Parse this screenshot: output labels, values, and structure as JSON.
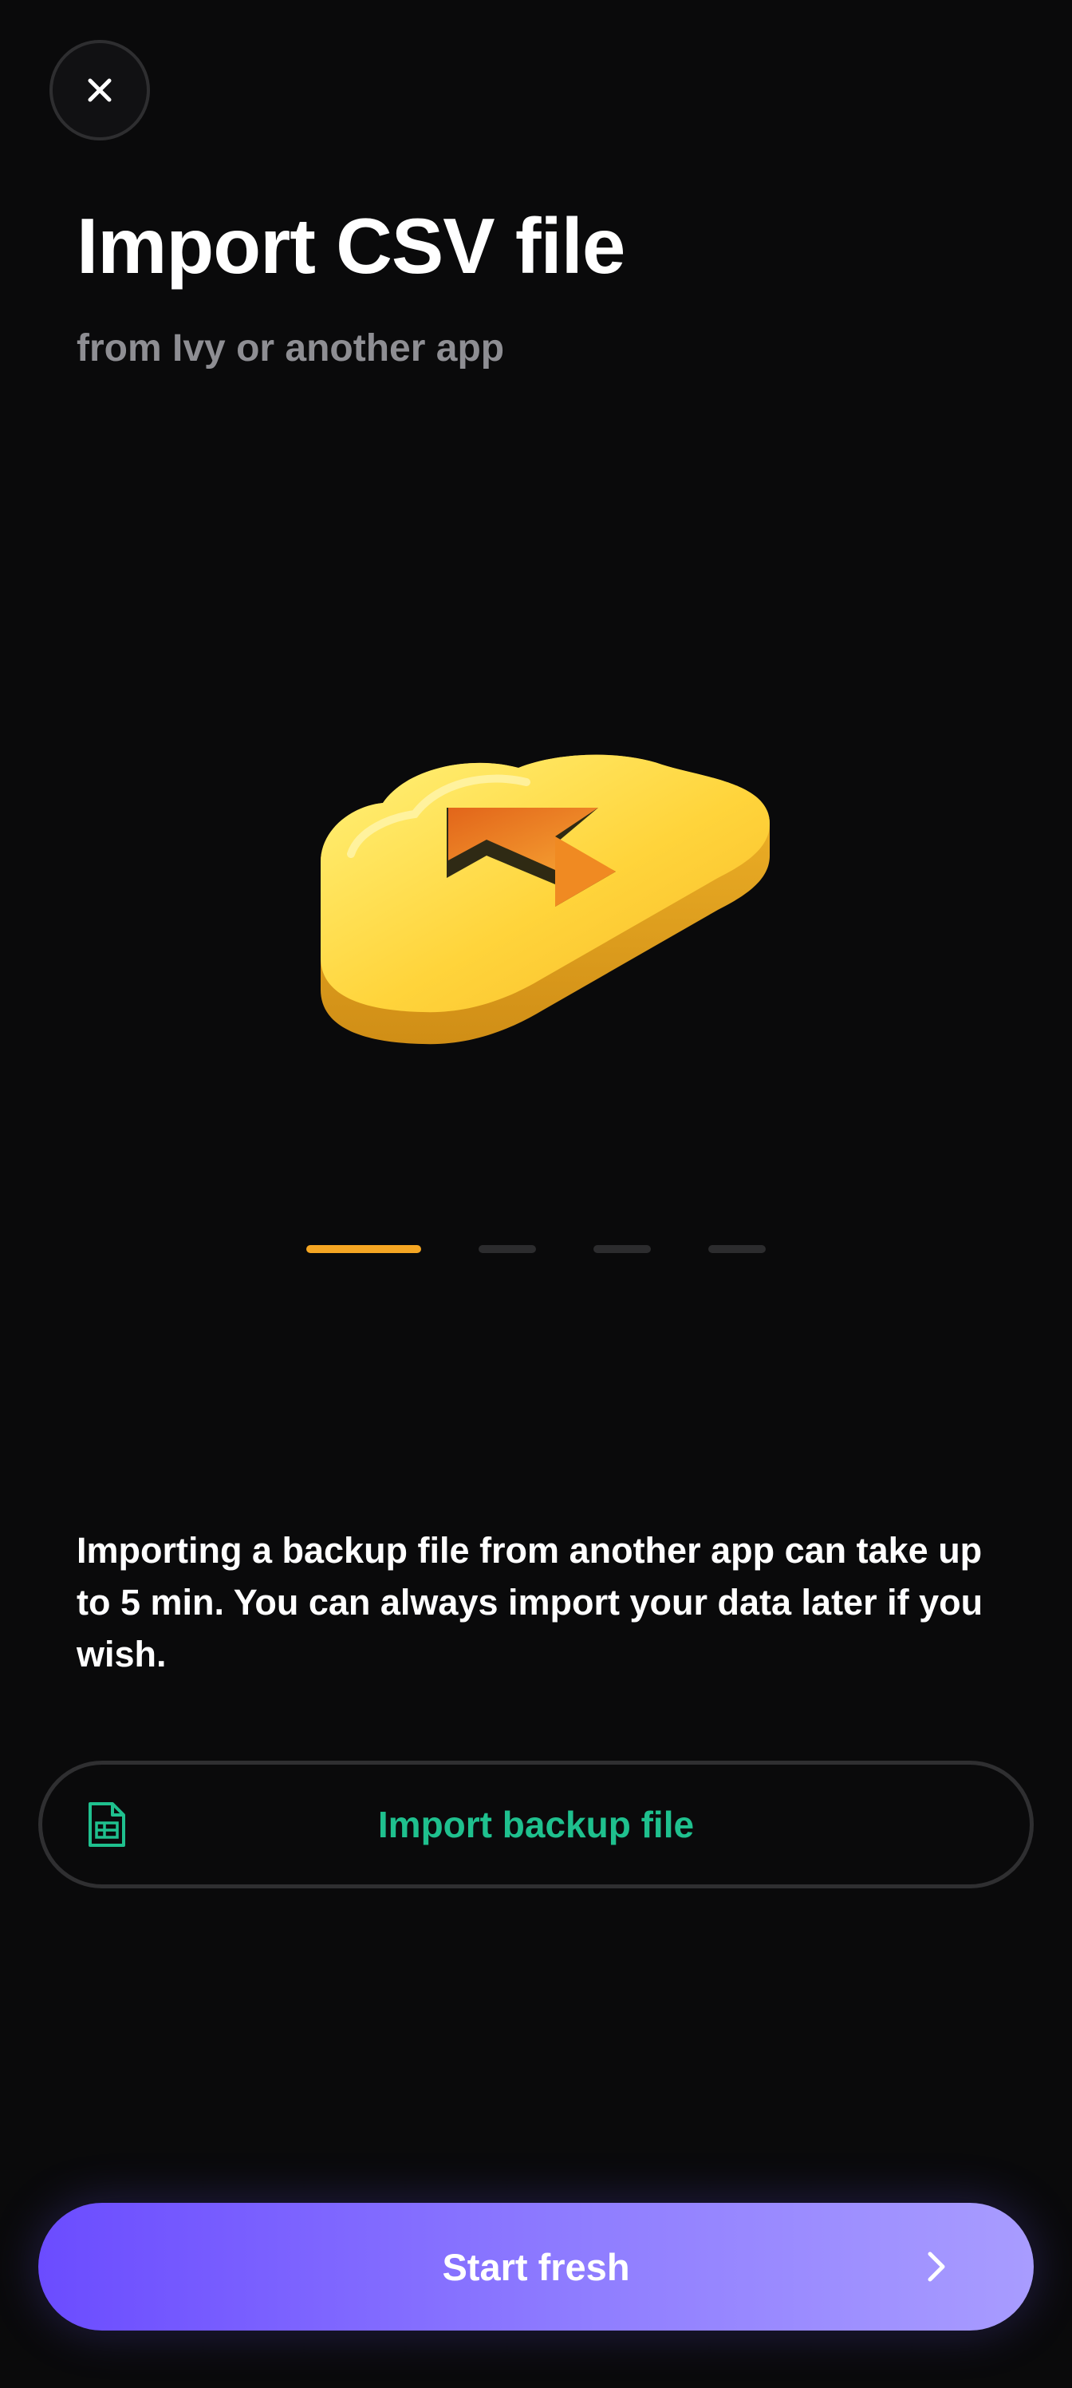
{
  "header": {
    "close_icon": "close-icon",
    "title": "Import CSV file",
    "subtitle": "from Ivy or another app"
  },
  "illustration": {
    "icon": "cloud-upload-icon",
    "colors": {
      "body": "#ffd43b",
      "side": "#e0a21a",
      "inner": "#f07f1a"
    }
  },
  "pager": {
    "count": 4,
    "active_index": 0,
    "active_color": "#f5a623",
    "inactive_color": "#2c2c2e"
  },
  "description": "Importing a backup file from another app can take up to 5 min. You can always import your data later if you wish.",
  "import_button": {
    "label": "Import backup file",
    "icon": "spreadsheet-file-icon",
    "accent": "#1fc08e"
  },
  "start_button": {
    "label": "Start fresh",
    "icon": "chevron-right-icon",
    "gradient": [
      "#6b4cff",
      "#a89cff"
    ]
  }
}
